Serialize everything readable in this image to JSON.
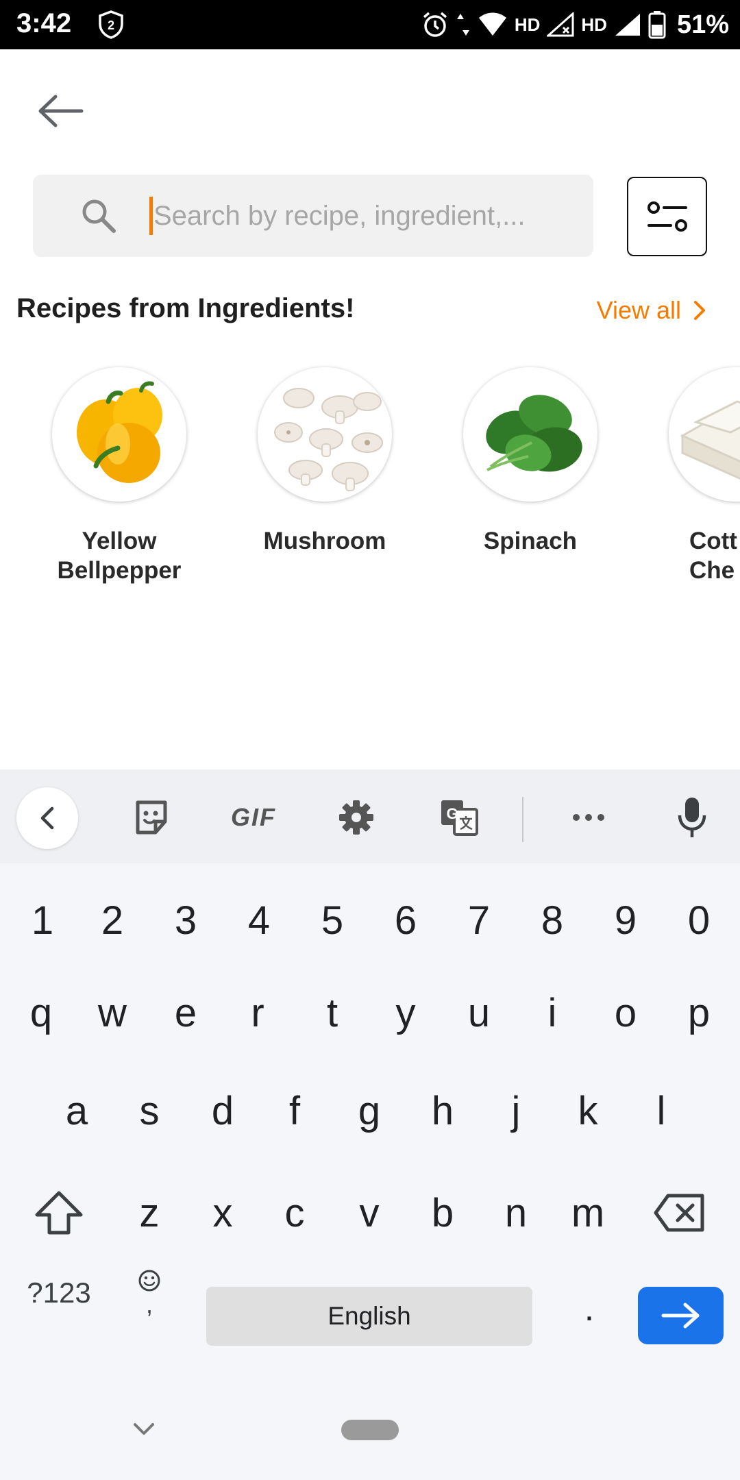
{
  "status_bar": {
    "time": "3:42",
    "notification_badge": "2",
    "network_label_1": "HD",
    "network_label_2": "HD",
    "battery": "51%"
  },
  "header": {
    "back_icon": "arrow-left-icon"
  },
  "search": {
    "placeholder": "Search by recipe, ingredient,...",
    "value": ""
  },
  "section": {
    "title": "Recipes from Ingredients!",
    "view_all": "View all"
  },
  "ingredients": [
    {
      "line1": "Yellow",
      "line2": "Bellpepper"
    },
    {
      "line1": "Mushroom",
      "line2": ""
    },
    {
      "line1": "Spinach",
      "line2": ""
    },
    {
      "line1": "Cott",
      "line2": "Che"
    }
  ],
  "keyboard": {
    "gif_label": "GIF",
    "number_row": [
      "1",
      "2",
      "3",
      "4",
      "5",
      "6",
      "7",
      "8",
      "9",
      "0"
    ],
    "row1": [
      "q",
      "w",
      "e",
      "r",
      "t",
      "y",
      "u",
      "i",
      "o",
      "p"
    ],
    "row2": [
      "a",
      "s",
      "d",
      "f",
      "g",
      "h",
      "j",
      "k",
      "l"
    ],
    "row3": [
      "z",
      "x",
      "c",
      "v",
      "b",
      "n",
      "m"
    ],
    "symbols_key": "?123",
    "emoji_comma": ",",
    "space_label": "English",
    "period_key": "."
  },
  "colors": {
    "accent": "#f57c00",
    "enter_key": "#1a73e8",
    "search_bg": "#f1f1f1",
    "keyboard_bg": "#f4f6f9"
  }
}
